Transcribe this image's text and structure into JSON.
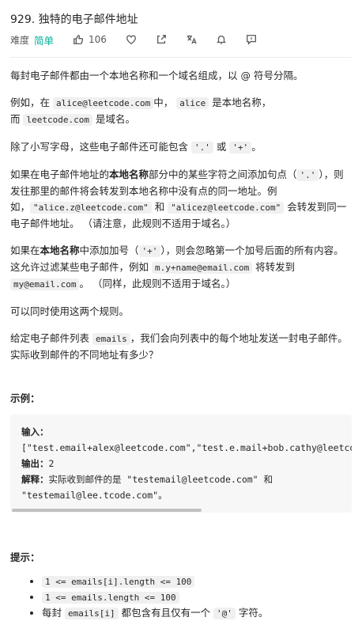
{
  "problem": {
    "title": "929. 独特的电子邮件地址",
    "difficulty_label": "难度",
    "difficulty": "简单",
    "likes": "106"
  },
  "icons": [
    "thumbs-up-icon",
    "heart-icon",
    "share-icon",
    "translate-icon",
    "bell-icon",
    "feedback-icon"
  ],
  "colors": {
    "accent": "#00af9b",
    "code_bg": "#f0f0f0",
    "example_bg": "#f7f7f8"
  },
  "desc": {
    "p1": "每封电子邮件都由一个本地名称和一个域名组成，以 @ 符号分隔。",
    "p2_a": "例如，在 ",
    "p2_code1": "alice@leetcode.com",
    "p2_b": "中， ",
    "p2_code2": "alice",
    "p2_c": " 是本地名称，",
    "p2_d": "而 ",
    "p2_code3": "leetcode.com",
    "p2_e": " 是域名。",
    "p3_a": "除了小写字母，这些电子邮件还可能包含 ",
    "p3_code1": "'.'",
    "p3_b": " 或 ",
    "p3_code2": "'+'",
    "p3_c": "。",
    "p4_a": "如果在电子邮件地址的",
    "p4_b": "本地名称",
    "p4_c": "部分中的某些字符之间添加句点（",
    "p4_code1": "'.'",
    "p4_d": "），则发往那里的邮件将会转发到本地名称中没有点的同一地址。例如，",
    "p4_code2": "\"alice.z@leetcode.com\"",
    "p4_e": " 和 ",
    "p4_code3": "\"alicez@leetcode.com\"",
    "p4_f": " 会转发到同一电子邮件地址。 （请注意，此规则不适用于域名。）",
    "p5_a": "如果在",
    "p5_b": "本地名称",
    "p5_c": "中添加加号（",
    "p5_code1": "'+'",
    "p5_d": "），则会忽略第一个加号后面的所有内容。这允许过滤某些电子邮件，例如 ",
    "p5_code2": "m.y+name@email.com",
    "p5_e": " 将转发到 ",
    "p5_code3": "my@email.com",
    "p5_f": "。 （同样，此规则不适用于域名。）",
    "p6": "可以同时使用这两个规则。",
    "p7_a": "给定电子邮件列表 ",
    "p7_code1": "emails",
    "p7_b": "，我们会向列表中的每个地址发送一封电子邮件。实际收到邮件的不同地址有多少？"
  },
  "example": {
    "heading": "示例：",
    "input_label": "输入：",
    "input_value": "[\"test.email+alex@leetcode.com\",\"test.e.mail+bob.cathy@leetcode.com\",\"testemail+david@lee.tcode.com\"]",
    "output_label": "输出：",
    "output_value": "2",
    "explain_label": "解释：",
    "explain_value": "实际收到邮件的是 \"testemail@leetcode.com\" 和",
    "explain_value2": "\"testemail@lee.tcode.com\"。"
  },
  "hints": {
    "heading": "提示：",
    "h1": "1 <= emails[i].length <= 100",
    "h2": "1 <= emails.length <= 100",
    "h3_a": "每封 ",
    "h3_code1": "emails[i]",
    "h3_b": " 都包含有且仅有一个 ",
    "h3_code2": "'@'",
    "h3_c": " 字符。"
  }
}
